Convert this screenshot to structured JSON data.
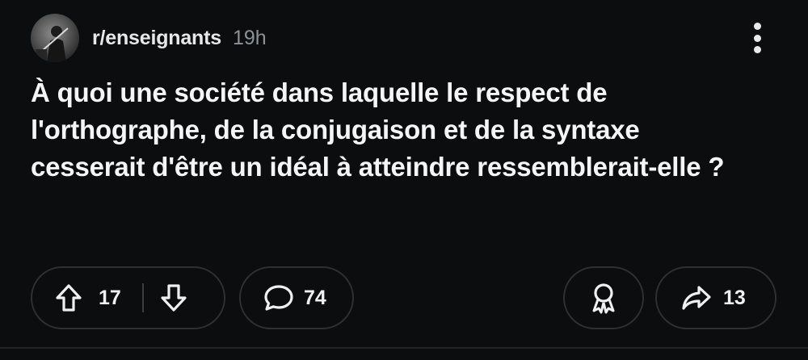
{
  "post": {
    "subreddit": "r/enseignants",
    "age": "19h",
    "title": "À quoi une société dans laquelle le respect de l'orthographe, de la conjugaison et de la syntaxe cesserait d'être un idéal à atteindre ressemblerait-elle ?"
  },
  "actions": {
    "upvotes": "17",
    "comments": "74",
    "shares": "13"
  },
  "icons": {
    "avatar": "subreddit-avatar",
    "more": "vertical-ellipsis-icon",
    "upvote": "upvote-arrow-icon",
    "downvote": "downvote-arrow-icon",
    "comment": "speech-bubble-icon",
    "award": "award-ribbon-icon",
    "share": "share-arrow-icon"
  },
  "colors": {
    "background": "#0b0d0e",
    "text": "#f3f5f6",
    "muted": "#8c9296",
    "pill_border": "#2d3133"
  }
}
